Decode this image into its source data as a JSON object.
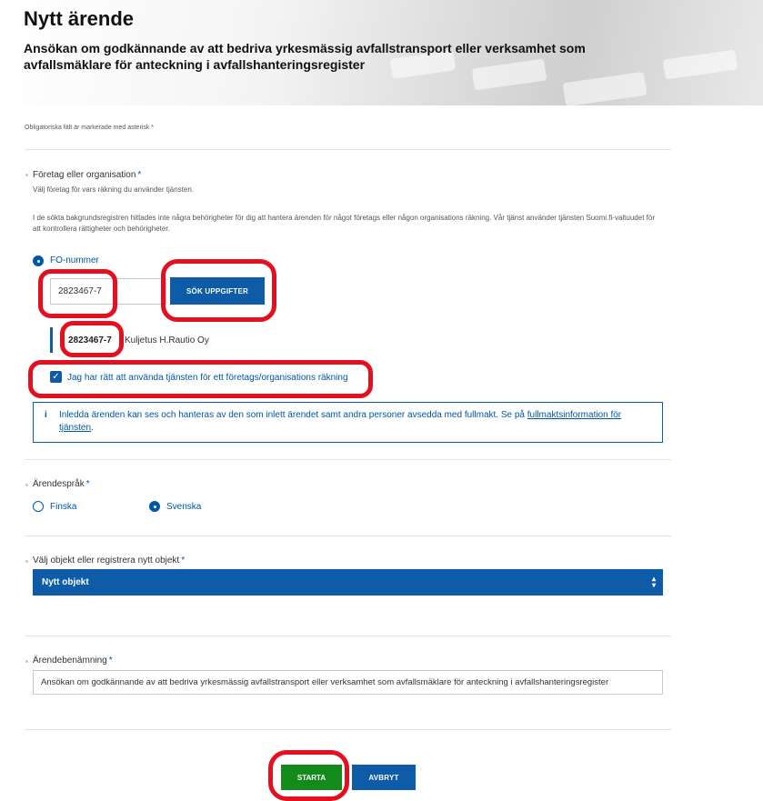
{
  "header": {
    "title": "Nytt ärende",
    "subtitle": "Ansökan om godkännande av att bedriva yrkesmässig avfallstransport eller verksamhet som avfallsmäklare för anteckning i avfallshanteringsregister"
  },
  "required_note": "Obligatoriska fält är markerade med asterisk *",
  "organization": {
    "label": "Företag eller organisation",
    "required_mark": "*",
    "help": "Välj företag för vars räkning du använder tjänsten.",
    "notice": "I de sökta bakgrundsregistren hittades inte några behörigheter för dig att hantera ärenden för något företags eller någon organisations räkning. Vår tjänst använder tjänsten Suomi.fi-valtuudet för att kontrollera rättigheter och behörigheter.",
    "id_type_label": "FO-nummer",
    "id_value": "2823467-7",
    "search_button": "SÖK UPPGIFTER",
    "result_id": "2823467-7",
    "result_name": "Kuljetus H.Rautio Oy",
    "checkbox_label": "Jag har rätt att använda tjänsten för ett företags/organisations räkning",
    "checkbox_checked": true,
    "info_icon": "i",
    "info_text": "Inledda ärenden kan ses och hanteras av den som inlett ärendet samt andra personer avsedda med fullmakt. Se på ",
    "info_link": "fullmaktsinformation för tjänsten",
    "info_end": "."
  },
  "language": {
    "label": "Ärendespråk",
    "required_mark": "*",
    "options": [
      "Finska",
      "Svenska"
    ],
    "selected": "Svenska"
  },
  "object": {
    "label": "Välj objekt eller registrera nytt objekt",
    "required_mark": "*",
    "selected": "Nytt objekt"
  },
  "case_name": {
    "label": "Ärendebenämning",
    "required_mark": "*",
    "value": "Ansökan om godkännande av att bedriva yrkesmässig avfallstransport eller verksamhet som avfallsmäklare för anteckning i avfallshanteringsregister"
  },
  "actions": {
    "start": "STARTA",
    "cancel": "AVBRYT"
  },
  "colors": {
    "primary": "#0e5ca7",
    "success": "#138a19",
    "highlight": "#e3101f"
  }
}
